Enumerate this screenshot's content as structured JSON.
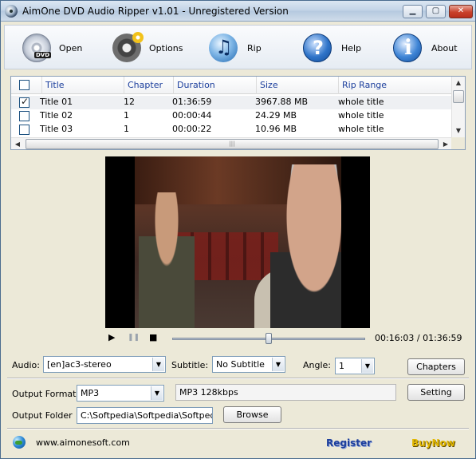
{
  "window": {
    "title": "AimOne DVD Audio Ripper v1.01 - Unregistered Version",
    "min_symbol": "▁",
    "max_symbol": "▢",
    "close_symbol": "✕"
  },
  "toolbar": {
    "open_label": "Open",
    "options_label": "Options",
    "rip_label": "Rip",
    "help_label": "Help",
    "about_label": "About"
  },
  "titles_table": {
    "columns": [
      "Title",
      "Chapter",
      "Duration",
      "Size",
      "Rip Range"
    ],
    "rows": [
      {
        "checked": true,
        "title": "Title 01",
        "chapter": "12",
        "duration": "01:36:59",
        "size": "3967.88 MB",
        "range": "whole title"
      },
      {
        "checked": false,
        "title": "Title 02",
        "chapter": "1",
        "duration": "00:00:44",
        "size": "24.29 MB",
        "range": "whole title"
      },
      {
        "checked": false,
        "title": "Title 03",
        "chapter": "1",
        "duration": "00:00:22",
        "size": "10.96 MB",
        "range": "whole title"
      }
    ]
  },
  "player": {
    "play_symbol": "▶",
    "pause_symbol": "❚❚",
    "stop_symbol": "■",
    "position": 0.5,
    "time": "00:16:03 / 01:36:59"
  },
  "audio": {
    "label": "Audio:",
    "value": "[en]ac3-stereo"
  },
  "subtitle": {
    "label": "Subtitle:",
    "value": "No Subtitle"
  },
  "angle": {
    "label": "Angle:",
    "value": "1"
  },
  "chapters_button": "Chapters",
  "output_format": {
    "label": "Output Format",
    "value": "MP3",
    "quality": "MP3  128kbps"
  },
  "setting_button": "Setting",
  "output_folder": {
    "label": "Output Folder",
    "value": "C:\\Softpedia\\Softpedia\\Softpedia"
  },
  "browse_button": "Browse",
  "footer": {
    "website": "www.aimonesoft.com",
    "register": "Register",
    "buynow": "BuyNow"
  },
  "scroll_symbols": {
    "up": "▲",
    "down": "▼",
    "left": "◀",
    "right": "▶",
    "grip": "|||",
    "dropdown": "▼"
  }
}
